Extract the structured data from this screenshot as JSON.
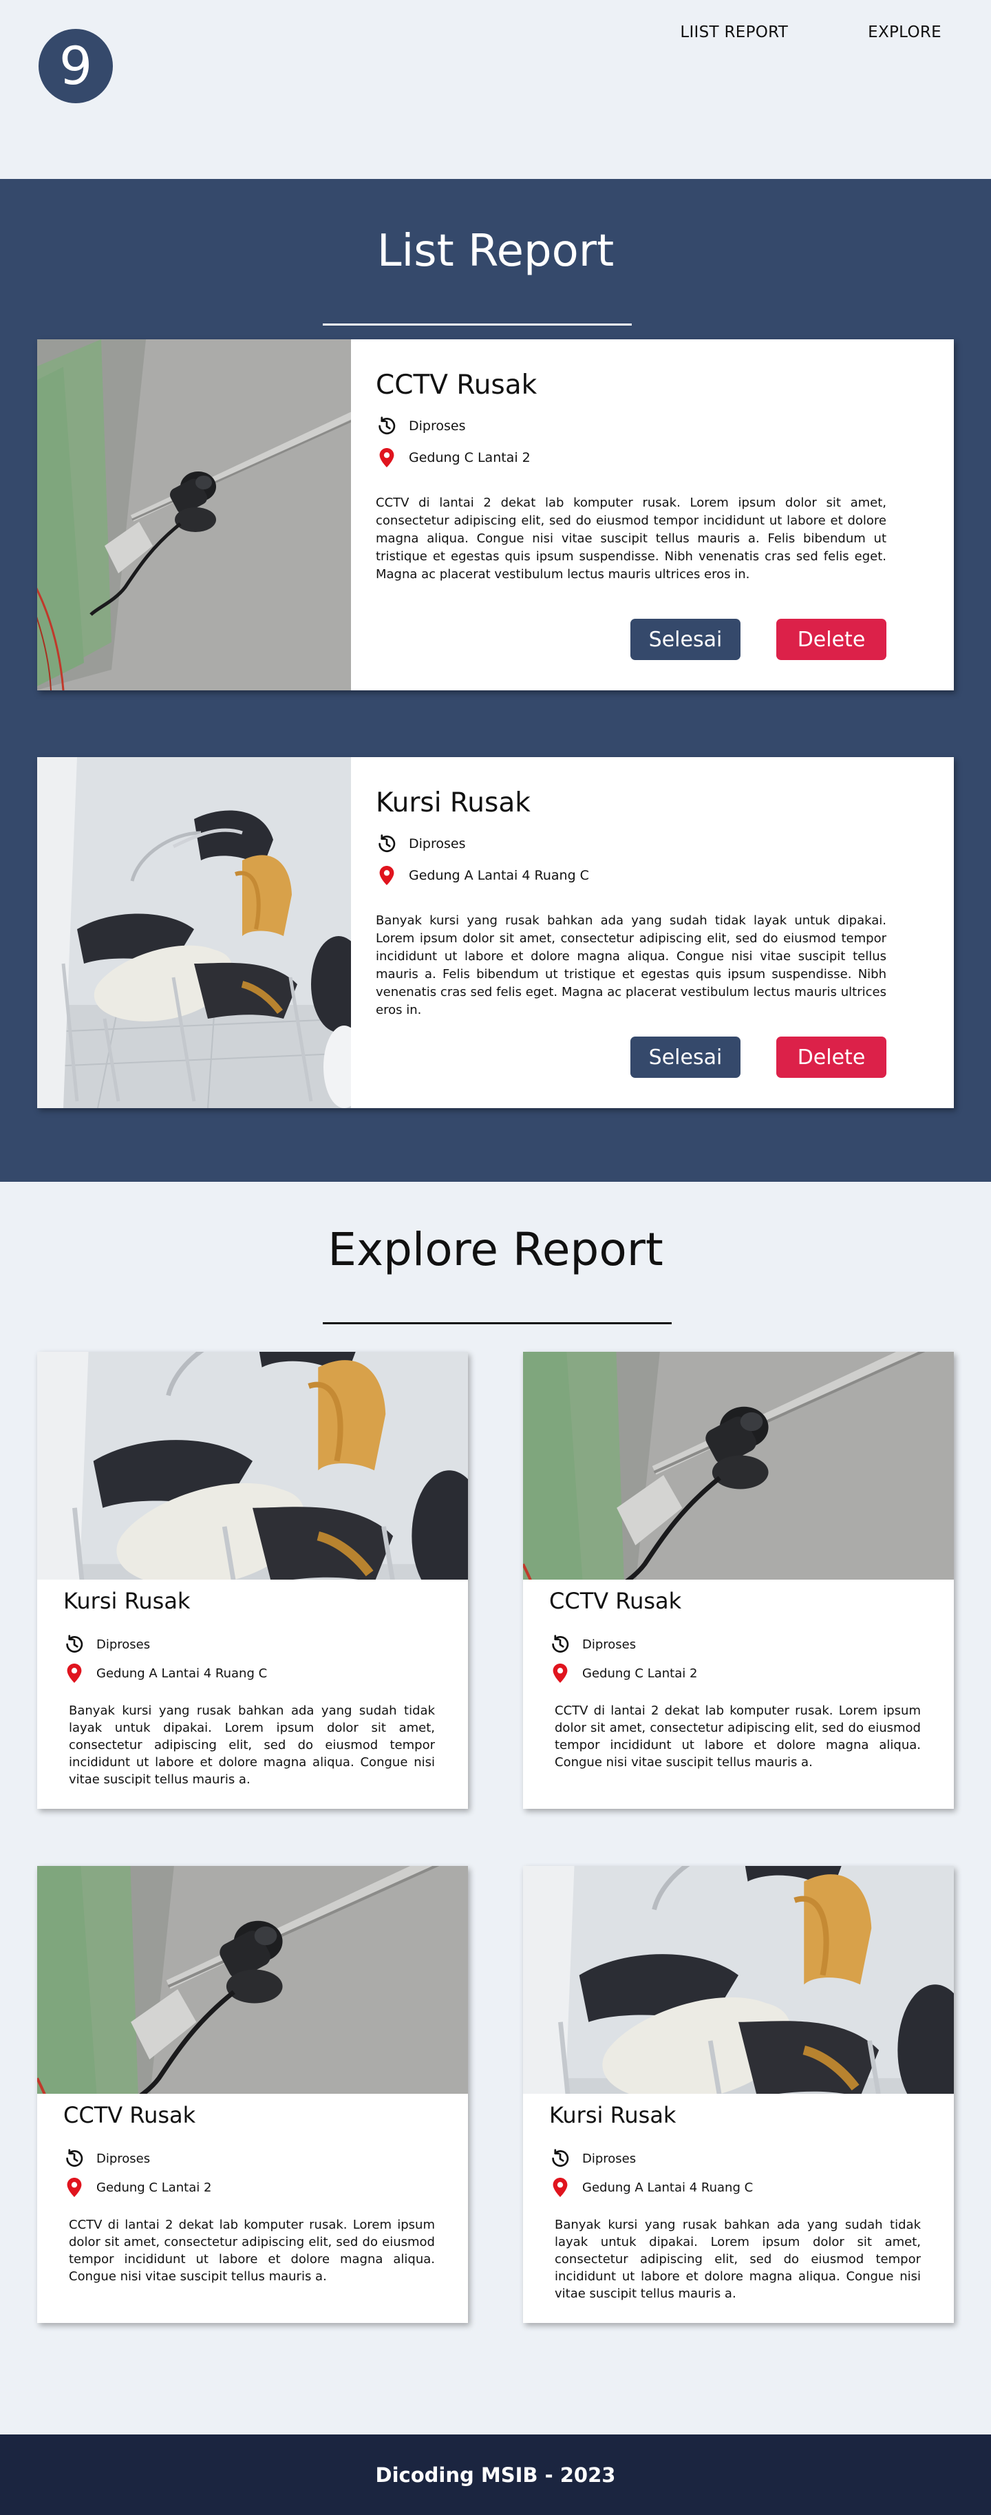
{
  "logo": {
    "text": "9"
  },
  "nav": {
    "items": [
      "LIIST REPORT",
      "EXPLORE"
    ]
  },
  "list_section": {
    "title": "List Report",
    "reports": [
      {
        "title": "CCTV Rusak",
        "status": "Diproses",
        "location": "Gedung C Lantai 2",
        "description": "CCTV di lantai 2 dekat lab komputer rusak. Lorem ipsum dolor sit amet, consectetur adipiscing elit, sed do eiusmod tempor incididunt ut labore et dolore magna aliqua. Congue nisi vitae suscipit tellus mauris a. Felis bibendum ut tristique et egestas quis ipsum suspendisse. Nibh venenatis cras sed felis eget. Magna ac placerat vestibulum lectus mauris ultrices eros in.",
        "image": "cctv-camera",
        "done_label": "Selesai",
        "delete_label": "Delete"
      },
      {
        "title": "Kursi Rusak",
        "status": "Diproses",
        "location": "Gedung A Lantai 4 Ruang C",
        "description": "Banyak kursi yang rusak bahkan ada yang sudah tidak layak untuk dipakai. Lorem ipsum dolor sit amet, consectetur adipiscing elit, sed do eiusmod tempor incididunt ut labore et dolore magna aliqua. Congue nisi vitae suscipit tellus mauris a. Felis bibendum ut tristique et egestas quis ipsum suspendisse. Nibh venenatis cras sed felis eget. Magna ac placerat vestibulum lectus mauris ultrices eros in.",
        "image": "broken-chairs",
        "done_label": "Selesai",
        "delete_label": "Delete"
      }
    ]
  },
  "explore_section": {
    "title": "Explore Report",
    "cards": [
      {
        "title": "Kursi Rusak",
        "status": "Diproses",
        "location": "Gedung A Lantai 4 Ruang C",
        "description": "Banyak kursi yang rusak bahkan ada yang sudah tidak layak untuk dipakai. Lorem ipsum dolor sit amet, consectetur adipiscing elit, sed do eiusmod tempor incididunt ut labore et dolore magna aliqua. Congue nisi vitae suscipit tellus mauris a.",
        "image": "broken-chairs"
      },
      {
        "title": "CCTV Rusak",
        "status": "Diproses",
        "location": "Gedung C Lantai 2",
        "description": "CCTV di lantai 2 dekat lab komputer rusak. Lorem ipsum dolor sit amet, consectetur adipiscing elit, sed do eiusmod tempor incididunt ut labore et dolore magna aliqua. Congue nisi vitae suscipit tellus mauris a.",
        "image": "cctv-camera"
      },
      {
        "title": "CCTV Rusak",
        "status": "Diproses",
        "location": "Gedung C Lantai 2",
        "description": "CCTV di lantai 2 dekat lab komputer rusak. Lorem ipsum dolor sit amet, consectetur adipiscing elit, sed do eiusmod tempor incididunt ut labore et dolore magna aliqua. Congue nisi vitae suscipit tellus mauris a.",
        "image": "cctv-camera"
      },
      {
        "title": "Kursi Rusak",
        "status": "Diproses",
        "location": "Gedung A Lantai 4 Ruang C",
        "description": "Banyak kursi yang rusak bahkan ada yang sudah tidak layak untuk dipakai. Lorem ipsum dolor sit amet, consectetur adipiscing elit, sed do eiusmod tempor incididunt ut labore et dolore magna aliqua. Congue nisi vitae suscipit tellus mauris a.",
        "image": "broken-chairs"
      }
    ]
  },
  "footer": {
    "text": "Dicoding MSIB - 2023"
  },
  "colors": {
    "primary": "#35496b",
    "danger": "#dc2149",
    "background": "#edf1f6",
    "footer": "#1b2540",
    "pin": "#e0141e"
  }
}
